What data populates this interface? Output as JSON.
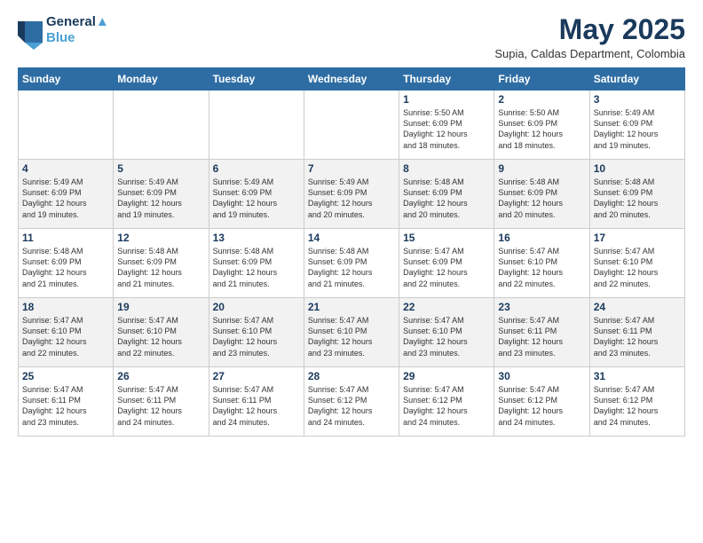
{
  "header": {
    "logo_line1": "General",
    "logo_line2": "Blue",
    "month_title": "May 2025",
    "location": "Supia, Caldas Department, Colombia"
  },
  "days_of_week": [
    "Sunday",
    "Monday",
    "Tuesday",
    "Wednesday",
    "Thursday",
    "Friday",
    "Saturday"
  ],
  "weeks": [
    [
      {
        "day": "",
        "content": ""
      },
      {
        "day": "",
        "content": ""
      },
      {
        "day": "",
        "content": ""
      },
      {
        "day": "",
        "content": ""
      },
      {
        "day": "1",
        "content": "Sunrise: 5:50 AM\nSunset: 6:09 PM\nDaylight: 12 hours\nand 18 minutes."
      },
      {
        "day": "2",
        "content": "Sunrise: 5:50 AM\nSunset: 6:09 PM\nDaylight: 12 hours\nand 18 minutes."
      },
      {
        "day": "3",
        "content": "Sunrise: 5:49 AM\nSunset: 6:09 PM\nDaylight: 12 hours\nand 19 minutes."
      }
    ],
    [
      {
        "day": "4",
        "content": "Sunrise: 5:49 AM\nSunset: 6:09 PM\nDaylight: 12 hours\nand 19 minutes."
      },
      {
        "day": "5",
        "content": "Sunrise: 5:49 AM\nSunset: 6:09 PM\nDaylight: 12 hours\nand 19 minutes."
      },
      {
        "day": "6",
        "content": "Sunrise: 5:49 AM\nSunset: 6:09 PM\nDaylight: 12 hours\nand 19 minutes."
      },
      {
        "day": "7",
        "content": "Sunrise: 5:49 AM\nSunset: 6:09 PM\nDaylight: 12 hours\nand 20 minutes."
      },
      {
        "day": "8",
        "content": "Sunrise: 5:48 AM\nSunset: 6:09 PM\nDaylight: 12 hours\nand 20 minutes."
      },
      {
        "day": "9",
        "content": "Sunrise: 5:48 AM\nSunset: 6:09 PM\nDaylight: 12 hours\nand 20 minutes."
      },
      {
        "day": "10",
        "content": "Sunrise: 5:48 AM\nSunset: 6:09 PM\nDaylight: 12 hours\nand 20 minutes."
      }
    ],
    [
      {
        "day": "11",
        "content": "Sunrise: 5:48 AM\nSunset: 6:09 PM\nDaylight: 12 hours\nand 21 minutes."
      },
      {
        "day": "12",
        "content": "Sunrise: 5:48 AM\nSunset: 6:09 PM\nDaylight: 12 hours\nand 21 minutes."
      },
      {
        "day": "13",
        "content": "Sunrise: 5:48 AM\nSunset: 6:09 PM\nDaylight: 12 hours\nand 21 minutes."
      },
      {
        "day": "14",
        "content": "Sunrise: 5:48 AM\nSunset: 6:09 PM\nDaylight: 12 hours\nand 21 minutes."
      },
      {
        "day": "15",
        "content": "Sunrise: 5:47 AM\nSunset: 6:09 PM\nDaylight: 12 hours\nand 22 minutes."
      },
      {
        "day": "16",
        "content": "Sunrise: 5:47 AM\nSunset: 6:10 PM\nDaylight: 12 hours\nand 22 minutes."
      },
      {
        "day": "17",
        "content": "Sunrise: 5:47 AM\nSunset: 6:10 PM\nDaylight: 12 hours\nand 22 minutes."
      }
    ],
    [
      {
        "day": "18",
        "content": "Sunrise: 5:47 AM\nSunset: 6:10 PM\nDaylight: 12 hours\nand 22 minutes."
      },
      {
        "day": "19",
        "content": "Sunrise: 5:47 AM\nSunset: 6:10 PM\nDaylight: 12 hours\nand 22 minutes."
      },
      {
        "day": "20",
        "content": "Sunrise: 5:47 AM\nSunset: 6:10 PM\nDaylight: 12 hours\nand 23 minutes."
      },
      {
        "day": "21",
        "content": "Sunrise: 5:47 AM\nSunset: 6:10 PM\nDaylight: 12 hours\nand 23 minutes."
      },
      {
        "day": "22",
        "content": "Sunrise: 5:47 AM\nSunset: 6:10 PM\nDaylight: 12 hours\nand 23 minutes."
      },
      {
        "day": "23",
        "content": "Sunrise: 5:47 AM\nSunset: 6:11 PM\nDaylight: 12 hours\nand 23 minutes."
      },
      {
        "day": "24",
        "content": "Sunrise: 5:47 AM\nSunset: 6:11 PM\nDaylight: 12 hours\nand 23 minutes."
      }
    ],
    [
      {
        "day": "25",
        "content": "Sunrise: 5:47 AM\nSunset: 6:11 PM\nDaylight: 12 hours\nand 23 minutes."
      },
      {
        "day": "26",
        "content": "Sunrise: 5:47 AM\nSunset: 6:11 PM\nDaylight: 12 hours\nand 24 minutes."
      },
      {
        "day": "27",
        "content": "Sunrise: 5:47 AM\nSunset: 6:11 PM\nDaylight: 12 hours\nand 24 minutes."
      },
      {
        "day": "28",
        "content": "Sunrise: 5:47 AM\nSunset: 6:12 PM\nDaylight: 12 hours\nand 24 minutes."
      },
      {
        "day": "29",
        "content": "Sunrise: 5:47 AM\nSunset: 6:12 PM\nDaylight: 12 hours\nand 24 minutes."
      },
      {
        "day": "30",
        "content": "Sunrise: 5:47 AM\nSunset: 6:12 PM\nDaylight: 12 hours\nand 24 minutes."
      },
      {
        "day": "31",
        "content": "Sunrise: 5:47 AM\nSunset: 6:12 PM\nDaylight: 12 hours\nand 24 minutes."
      }
    ]
  ]
}
